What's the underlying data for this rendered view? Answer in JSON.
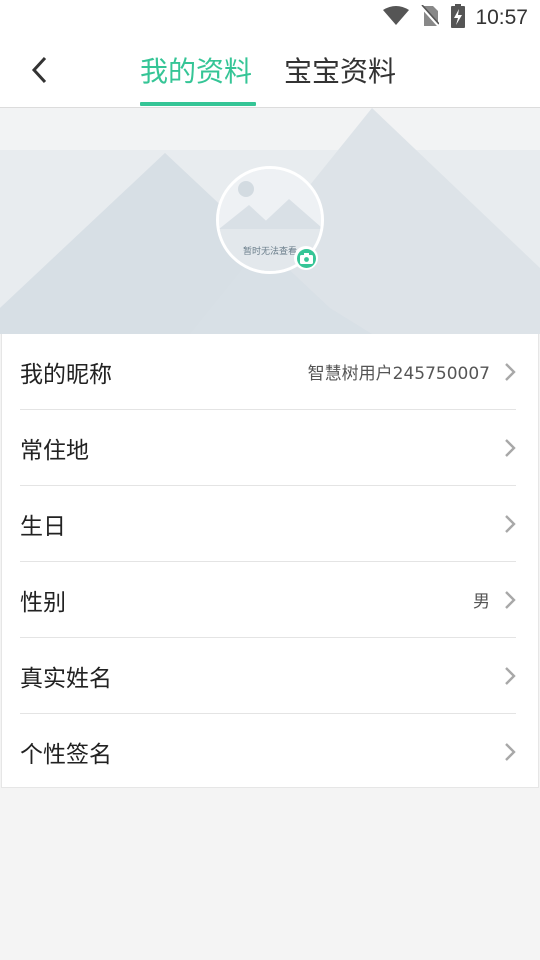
{
  "status_bar": {
    "time": "10:57",
    "icons": [
      "wifi-icon",
      "no-sim-icon",
      "battery-charging-icon"
    ]
  },
  "header": {
    "back_icon": "chevron-left-icon",
    "tabs": [
      {
        "label": "我的资料",
        "active": true
      },
      {
        "label": "宝宝资料",
        "active": false
      }
    ],
    "accent_color": "#35c596"
  },
  "avatar": {
    "caption": "暂时无法查看",
    "badge_icon": "camera-icon"
  },
  "profile_rows": [
    {
      "label": "我的昵称",
      "value": "智慧树用户245750007"
    },
    {
      "label": "常住地",
      "value": ""
    },
    {
      "label": "生日",
      "value": ""
    },
    {
      "label": "性别",
      "value": "男"
    },
    {
      "label": "真实姓名",
      "value": ""
    },
    {
      "label": "个性签名",
      "value": ""
    }
  ]
}
